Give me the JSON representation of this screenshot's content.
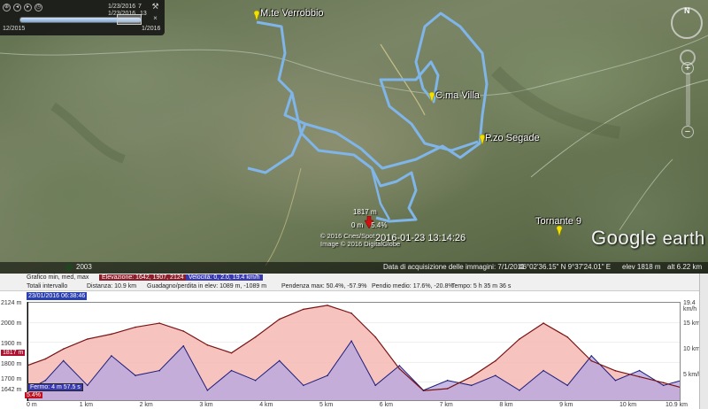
{
  "time_slider": {
    "date_top_1": "1/23/2016",
    "num_top": "7",
    "date_top_2": "1/23/2016",
    "num_top_2": "13",
    "start": "12/2015",
    "end": "1/2016"
  },
  "placemarks": [
    {
      "name": "M.te Verrobbio"
    },
    {
      "name": "C.ma Villa"
    },
    {
      "name": "P.zo Segade"
    },
    {
      "name": "Tornante 9"
    }
  ],
  "cursor": {
    "elevation": "1817 m",
    "distance": "0 m",
    "grade": "5.4%",
    "timestamp": "2016-01-23 13:14:26"
  },
  "copyright": {
    "line1": "© 2016 Cnes/Spot",
    "line2": "Image © 2016 DigitalGlobe"
  },
  "logo": {
    "part1": "Google",
    "part2": "earth"
  },
  "status_bar": {
    "year": "2003",
    "imagery_date": "Data di acquisizione delle immagini: 7/1/2011",
    "coords": "46°02'36.15\" N  9°37'24.01\" E",
    "elev": "elev  1818 m",
    "alt": "alt  6.22 km"
  },
  "profile": {
    "row1_label": "Grafico  min, med, max",
    "elevation_chip": "Elevazione: 1642, 1907, 2124 m",
    "speed_chip": "Velocità: 0, 2.0, 19.4 km/h",
    "row2_label": "Totali intervallo",
    "distance": "Distanza: 10.9 km",
    "gain_loss": "Guadagno/perdita in elev: 1089 m, -1089 m",
    "slope_max": "Pendenza max: 50.4%, -57.9%",
    "slope_avg": "Pendio medio: 17.6%, -20.8%",
    "time": "Tempo: 5 h 35 m 36 s",
    "cursor_date": "23/01/2016 06:38:46",
    "elev_badge": "1817 m",
    "pct_badge": "5.4%",
    "cursor_tip": "Fermo: 4 m 57.5 s",
    "close": "×"
  },
  "colors": {
    "track": "#7fb5e8",
    "elevation_fill": "#f4b8b4",
    "elevation_line": "#7a1414",
    "speed_fill": "#b8a8e0",
    "speed_line": "#1d1d7a"
  },
  "chart_data": {
    "type": "area",
    "y_left_ticks": [
      "2124 m",
      "2000 m",
      "1900 m",
      "1800 m",
      "1700 m",
      "1642 m"
    ],
    "y_right_ticks": [
      "19.4 km/h",
      "15 km/h",
      "10 km/h",
      "5 km/h"
    ],
    "x_ticks": [
      "0 m",
      "1 km",
      "2 km",
      "3 km",
      "4 km",
      "5 km",
      "6 km",
      "7 km",
      "8 km",
      "9 km",
      "10 km",
      "10.9 km"
    ],
    "elevation_range": [
      1642,
      2124
    ],
    "speed_range": [
      0,
      19.4
    ],
    "elevation_km": [
      0,
      0.3,
      0.6,
      1.0,
      1.4,
      1.8,
      2.2,
      2.6,
      3.0,
      3.4,
      3.8,
      4.2,
      4.6,
      5.0,
      5.4,
      5.8,
      6.2,
      6.6,
      7.0,
      7.4,
      7.8,
      8.2,
      8.6,
      9.0,
      9.4,
      9.8,
      10.2,
      10.6,
      10.9
    ],
    "elevation_m": [
      1817,
      1850,
      1900,
      1950,
      1975,
      2010,
      2030,
      1990,
      1920,
      1880,
      1960,
      2050,
      2100,
      2120,
      2080,
      1960,
      1800,
      1690,
      1700,
      1760,
      1840,
      1950,
      2030,
      1960,
      1840,
      1790,
      1760,
      1730,
      1705
    ],
    "speed_kmh": [
      2,
      4,
      8,
      3,
      9,
      5,
      6,
      11,
      2,
      6,
      4,
      8,
      3,
      5,
      12,
      3,
      7,
      2,
      4,
      3,
      5,
      2,
      6,
      3,
      9,
      4,
      6,
      3,
      4
    ]
  }
}
